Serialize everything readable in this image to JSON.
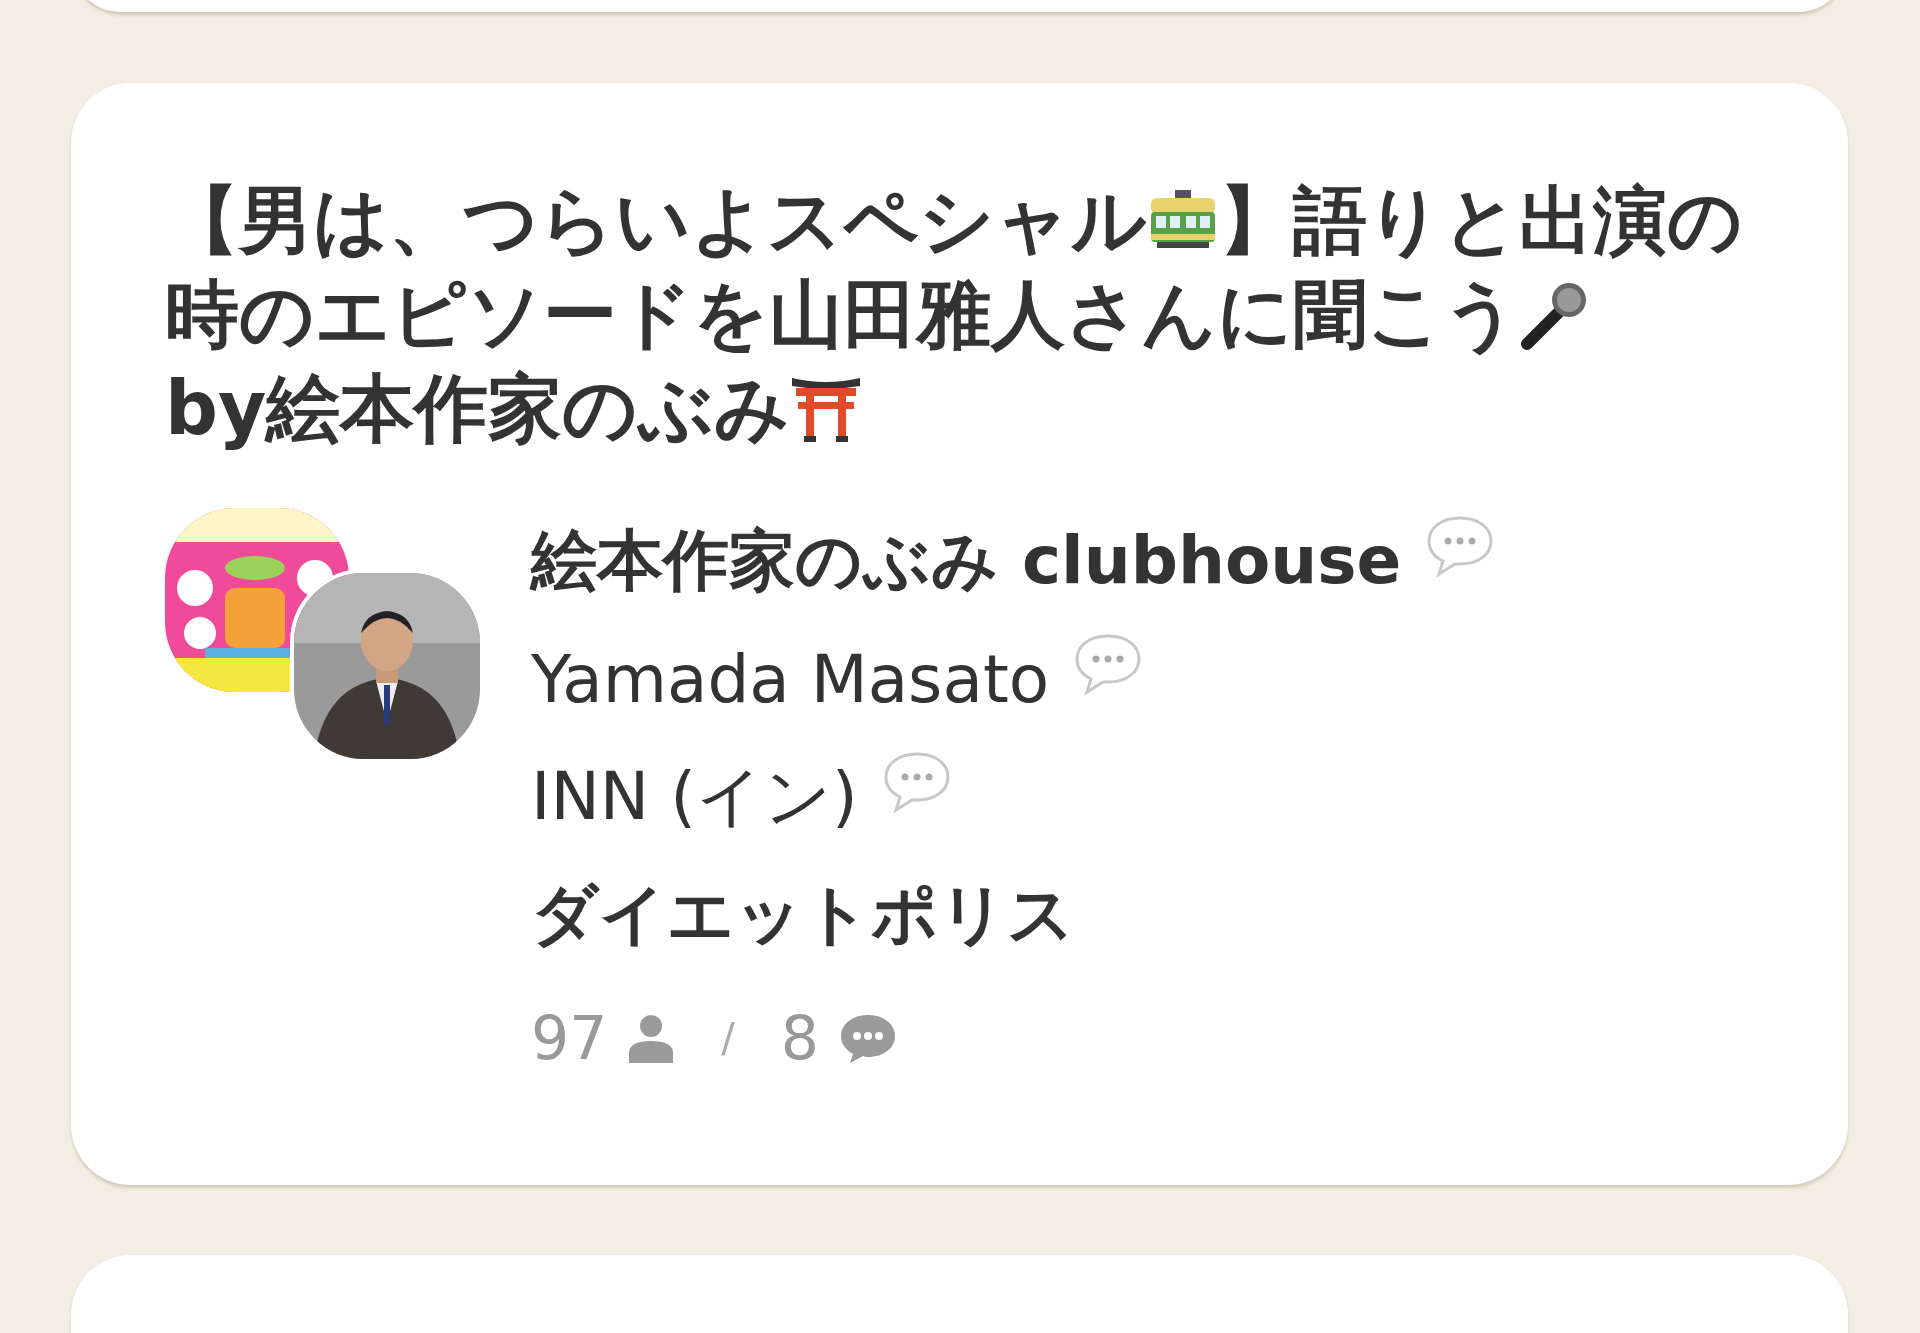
{
  "room": {
    "title": [
      {
        "kind": "text",
        "text": "【男は、つらいよスペシャル"
      },
      {
        "kind": "tram"
      },
      {
        "kind": "text",
        "text": "】語りと出演の"
      },
      {
        "kind": "text",
        "text": "時のエピソードを山田雅人さんに聞こう"
      },
      {
        "kind": "microphone"
      },
      {
        "kind": "text",
        "text": "by絵"
      },
      {
        "kind": "text",
        "text": "本作家のぶみ"
      },
      {
        "kind": "torii"
      }
    ],
    "speakers": [
      {
        "name": "絵本作家のぶみ clubhouse",
        "speaker": true
      },
      {
        "name": "Yamada Masato",
        "speaker": true
      },
      {
        "name": "INN (イン)",
        "speaker": true
      },
      {
        "name": "ダイエットポリス",
        "speaker": false
      }
    ],
    "stats": {
      "listeners": "97",
      "separator": "/",
      "speakers": "8"
    }
  }
}
